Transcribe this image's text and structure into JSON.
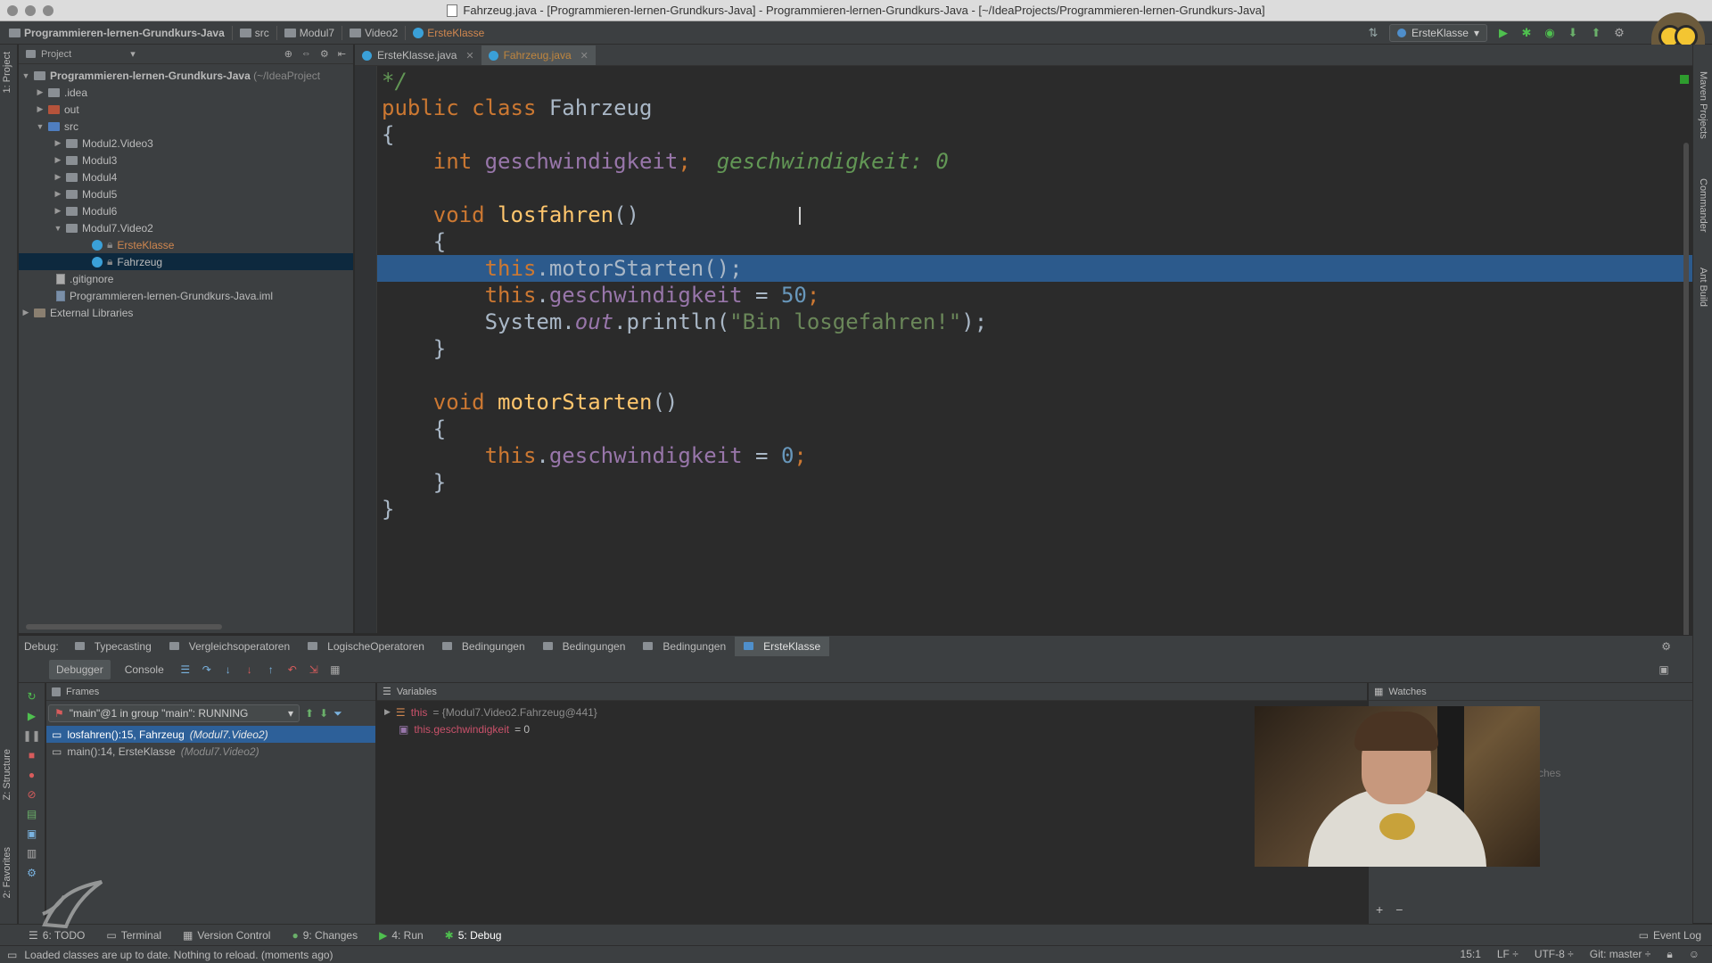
{
  "window": {
    "title": "Fahrzeug.java - [Programmieren-lernen-Grundkurs-Java] - Programmieren-lernen-Grundkurs-Java - [~/IdeaProjects/Programmieren-lernen-Grundkurs-Java]"
  },
  "breadcrumbs": [
    "Programmieren-lernen-Grundkurs-Java",
    "src",
    "Modul7",
    "Video2",
    "ErsteKlasse"
  ],
  "run_config": "ErsteKlasse",
  "project_panel": {
    "header": "Project",
    "root": "Programmieren-lernen-Grundkurs-Java",
    "root_path": "(~/IdeaProject",
    "items": [
      {
        "label": ".idea"
      },
      {
        "label": "out"
      },
      {
        "label": "src"
      },
      {
        "label": "Modul2.Video3"
      },
      {
        "label": "Modul3"
      },
      {
        "label": "Modul4"
      },
      {
        "label": "Modul5"
      },
      {
        "label": "Modul6"
      },
      {
        "label": "Modul7.Video2"
      },
      {
        "label": "ErsteKlasse"
      },
      {
        "label": "Fahrzeug"
      },
      {
        "label": ".gitignore"
      },
      {
        "label": "Programmieren-lernen-Grundkurs-Java.iml"
      },
      {
        "label": "External Libraries"
      }
    ]
  },
  "left_strip": {
    "project": "1: Project",
    "structure": "Z: Structure",
    "favorites": "2: Favorites"
  },
  "right_strip": {
    "maven": "Maven Projects",
    "commander": "Commander",
    "ant": "Ant Build"
  },
  "editor": {
    "tabs": [
      {
        "label": "ErsteKlasse.java"
      },
      {
        "label": "Fahrzeug.java"
      }
    ],
    "code": {
      "l0": "*/",
      "l1_kw": "public class ",
      "l1_name": "Fahrzeug",
      "brace_open": "{",
      "brace_close": "}",
      "l3_type": "int ",
      "l3_field": "geschwindigkeit",
      "l3_semi": ";",
      "l3_hint": "geschwindigkeit: 0",
      "l5_kw": "void ",
      "l5_fn": "losfahren",
      "parens": "()",
      "this": "this",
      "l7_call": ".motorStarten();",
      "dot": ".",
      "field": "geschwindigkeit",
      "assign_50_op": " = ",
      "num50": "50",
      "num0": "0",
      "semi": ";",
      "l9_sys": "System.",
      "l9_out": "out",
      "l9_print": ".println(",
      "l9_str": "\"Bin losgefahren!\"",
      "l9_end": ");",
      "l12_fn": "motorStarten"
    }
  },
  "debug": {
    "label": "Debug:",
    "tabs": [
      {
        "label": "Typecasting"
      },
      {
        "label": "Vergleichsoperatoren"
      },
      {
        "label": "LogischeOperatoren"
      },
      {
        "label": "Bedingungen"
      },
      {
        "label": "Bedingungen"
      },
      {
        "label": "Bedingungen"
      },
      {
        "label": "ErsteKlasse"
      }
    ],
    "subtabs": {
      "debugger": "Debugger",
      "console": "Console"
    },
    "frames": {
      "header": "Frames",
      "thread": "\"main\"@1 in group \"main\": RUNNING",
      "rows": [
        {
          "method": "losfahren():15, Fahrzeug",
          "loc": "(Modul7.Video2)"
        },
        {
          "method": "main():14, ErsteKlasse",
          "loc": "(Modul7.Video2)"
        }
      ]
    },
    "variables": {
      "header": "Variables",
      "rows": [
        {
          "name": "this",
          "value": " = {Modul7.Video2.Fahrzeug@441}"
        },
        {
          "name": "this.geschwindigkeit",
          "value": " = 0"
        }
      ]
    },
    "watches": {
      "header": "Watches",
      "hint": "ches",
      "add": "+",
      "remove": "−"
    }
  },
  "bottom_tabs": [
    {
      "label": "6: TODO"
    },
    {
      "label": "Terminal"
    },
    {
      "label": "Version Control"
    },
    {
      "label": "9: Changes"
    },
    {
      "label": "4: Run"
    },
    {
      "label": "5: Debug"
    }
  ],
  "event_log": "Event Log",
  "status": {
    "message": "Loaded classes are up to date. Nothing to reload. (moments ago)",
    "position": "15:1",
    "line_sep": "LF ÷",
    "encoding": "UTF-8 ÷",
    "git": "Git: master ÷"
  },
  "colors": {
    "accent_selection": "#2d6099",
    "editor_bg": "#2b2b2b",
    "panel_bg": "#3c3f41"
  }
}
